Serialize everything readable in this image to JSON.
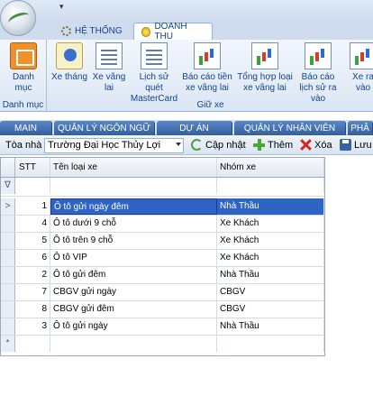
{
  "app": {
    "qat_symbol": "▾"
  },
  "ribbon": {
    "tabs": [
      {
        "label": "HỆ THỐNG"
      },
      {
        "label": "DOANH THU"
      }
    ],
    "group_danhmuc": {
      "button": "Danh mục",
      "label": "Danh mục"
    },
    "group_giuxe": {
      "label": "Giữ xe",
      "buttons": [
        {
          "label": "Xe tháng"
        },
        {
          "label": "Xe vãng lai"
        },
        {
          "label": "Lịch sử quét MasterCard"
        },
        {
          "label": "Báo cáo tiền xe vãng lai"
        },
        {
          "label": "Tổng hợp loại xe vãng lai"
        },
        {
          "label": "Báo cáo lịch sử ra vào"
        },
        {
          "label": "Xe ra vào"
        }
      ]
    }
  },
  "module_tabs": [
    {
      "label": "MAIN"
    },
    {
      "label": "QUẢN LÝ NGÔN NGỮ"
    },
    {
      "label": "DỰ ÁN"
    },
    {
      "label": "QUẢN LÝ NHÂN VIÊN"
    },
    {
      "label": "PHÂ"
    }
  ],
  "toolbar": {
    "building_label": "Tòa nhà",
    "building_value": "Trường Đại Học Thủy Lợi",
    "refresh": "Cập nhật",
    "add": "Thêm",
    "delete": "Xóa",
    "save": "Lưu"
  },
  "grid": {
    "headers": {
      "stt": "STT",
      "name": "Tên loại xe",
      "group": "Nhóm xe"
    },
    "filter_symbol": "∇",
    "new_row_symbol": "*",
    "current_row_symbol": ">",
    "rows": [
      {
        "stt": "1",
        "name": "Ô tô gửi ngày đêm",
        "group": "Nhà Thầu"
      },
      {
        "stt": "4",
        "name": "Ô tô dưới 9 chỗ",
        "group": "Xe Khách"
      },
      {
        "stt": "5",
        "name": "Ô tô trên 9 chỗ",
        "group": "Xe Khách"
      },
      {
        "stt": "6",
        "name": "Ô tô VIP",
        "group": "Xe Khách"
      },
      {
        "stt": "2",
        "name": "Ô tô gửi đêm",
        "group": "Nhà Thầu"
      },
      {
        "stt": "7",
        "name": "CBGV gửi ngày",
        "group": "CBGV"
      },
      {
        "stt": "8",
        "name": "CBGV gửi đêm",
        "group": "CBGV"
      },
      {
        "stt": "3",
        "name": "Ô tô gửi ngày",
        "group": "Nhà Thầu"
      }
    ]
  }
}
